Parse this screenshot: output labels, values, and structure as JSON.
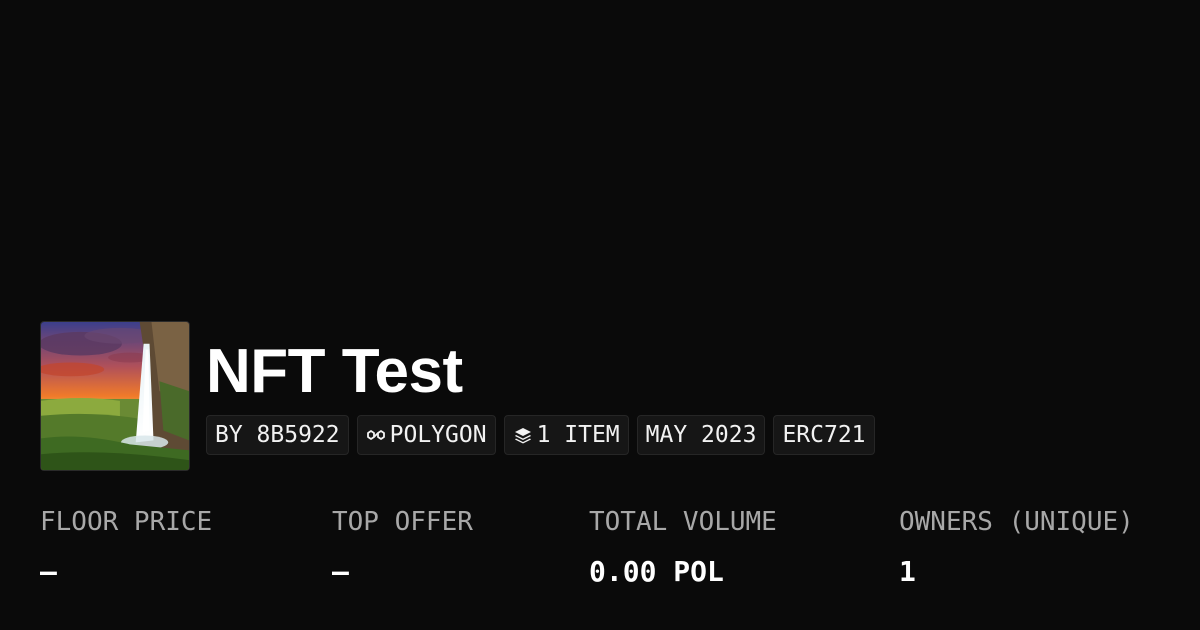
{
  "collection": {
    "title": "NFT Test",
    "thumbnail_icon": "waterfall-landscape-image"
  },
  "badges": {
    "creator": "BY 8B5922",
    "chain": "POLYGON",
    "chain_icon": "polygon-chain-icon",
    "items": "1 ITEM",
    "items_icon": "layers-icon",
    "date": "MAY 2023",
    "standard": "ERC721"
  },
  "stats": [
    {
      "label": "FLOOR PRICE",
      "value": "–"
    },
    {
      "label": "TOP OFFER",
      "value": "–"
    },
    {
      "label": "TOTAL VOLUME",
      "value": "0.00 POL"
    },
    {
      "label": "OWNERS (UNIQUE)",
      "value": "1"
    }
  ],
  "colors": {
    "background": "#0a0a0a",
    "badge_background": "#161616",
    "label_text": "#a8a8a8",
    "primary_text": "#ffffff"
  }
}
